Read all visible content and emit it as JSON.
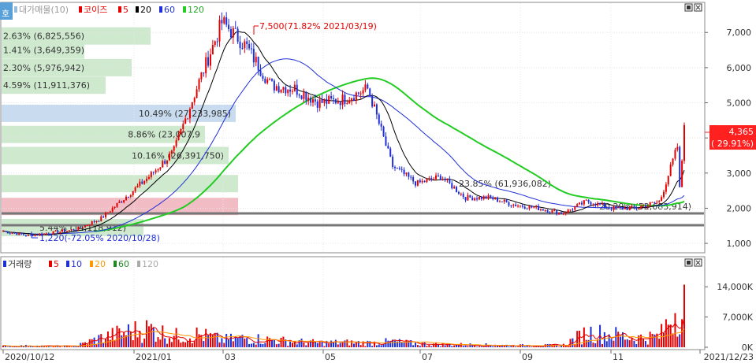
{
  "price_panel": {
    "legend": {
      "vp_tag": "호",
      "vp_label": "대가매물(10)",
      "series_name": "코이즈",
      "ma_labels": [
        "5",
        "20",
        "60",
        "120"
      ],
      "ma_colors": [
        "#e60000",
        "#000000",
        "#1f2fd8",
        "#22cc22"
      ]
    },
    "y_ticks": [
      "7,000",
      "6,000",
      "5,000",
      "4,000",
      "3,000",
      "2,000",
      "1,000"
    ],
    "last_price_box": {
      "price": "4,365",
      "change": "( 29.91%)",
      "color": "#ff2020"
    },
    "high_annotation": "7,500(71.82% 2021/03/19)",
    "low_annotation": "1,220(-72.05% 2020/10/28)",
    "volume_profile": [
      {
        "label": "2.63% (6,825,556)",
        "frac": 0.63,
        "color": "#cfe9cf"
      },
      {
        "label": "1.41% (3,649,359)",
        "frac": 0.35,
        "color": "#cfe9cf"
      },
      {
        "label": "2.30% (5,976,942)",
        "frac": 0.55,
        "color": "#cfe9cf"
      },
      {
        "label": "4.59% (11,911,376)",
        "frac": 0.44,
        "color": "#cfe9cf"
      },
      {
        "label": "10.49% (27,233,985)",
        "frac": 0.99,
        "color": "#c9dcef"
      },
      {
        "label": "8.86% (23,007,9",
        "frac": 0.86,
        "color": "#cfe9cf"
      },
      {
        "label": "10.16% (26,391,750)",
        "frac": 0.96,
        "color": "#cfe9cf"
      },
      {
        "label": "23.85% (61,936,082)",
        "frac": 1.0,
        "color": "#cfe9cf"
      },
      {
        "label": "20.29% (52,683,914)",
        "frac": 1.0,
        "color": "#f2bcc4"
      },
      {
        "label": "5.44% (14,118,912)",
        "frac": 0.6,
        "color": "#cfe9cf"
      }
    ]
  },
  "volume_panel": {
    "legend": {
      "title": "거래량",
      "ma_labels": [
        "5",
        "10",
        "20",
        "60",
        "120"
      ],
      "ma_colors": [
        "#e60000",
        "#1f2fd8",
        "#ff9900",
        "#228822",
        "#aaaaaa"
      ]
    },
    "y_ticks": [
      "14,000K",
      "7,000K",
      "0K"
    ]
  },
  "x_axis": {
    "ticks": [
      "2020/10/12",
      "2021/01",
      "03",
      "05",
      "07",
      "09",
      "11",
      "2021/12/23"
    ]
  },
  "chart_data": {
    "type": "candlestick",
    "period": {
      "start": "2020/10/12",
      "end": "2021/12/23"
    },
    "y_range": [
      1000,
      7700
    ],
    "volume_range_k": [
      0,
      14000
    ],
    "series": [
      {
        "name": "코이즈",
        "x": [
          "2020/10/12",
          "2020/10/28",
          "2020/11",
          "2020/12",
          "2021/01",
          "2021/01b",
          "2021/02",
          "2021/02b",
          "2021/03",
          "2021/03/19",
          "2021/04",
          "2021/04b",
          "2021/05",
          "2021/05b",
          "2021/06",
          "2021/06b",
          "2021/07",
          "2021/07b",
          "2021/08",
          "2021/08b",
          "2021/09",
          "2021/09b",
          "2021/10",
          "2021/10b",
          "2021/11",
          "2021/11b",
          "2021/12",
          "2021/12b",
          "2021/12/23"
        ],
        "values": [
          1350,
          1220,
          1300,
          1400,
          1700,
          2300,
          2900,
          3600,
          5500,
          7300,
          6600,
          5500,
          5400,
          5000,
          5100,
          5400,
          3200,
          2700,
          2900,
          2300,
          2300,
          2100,
          2000,
          1850,
          2200,
          2000,
          2000,
          2200,
          4365
        ]
      }
    ],
    "volume_k": [
      300,
      400,
      300,
      350,
      2500,
      4000,
      5000,
      3000,
      3500,
      2000,
      2500,
      2000,
      1500,
      1200,
      1300,
      1200,
      1500,
      1000,
      800,
      700,
      600,
      500,
      500,
      500,
      4000,
      3500,
      2500,
      3000,
      14500
    ]
  }
}
